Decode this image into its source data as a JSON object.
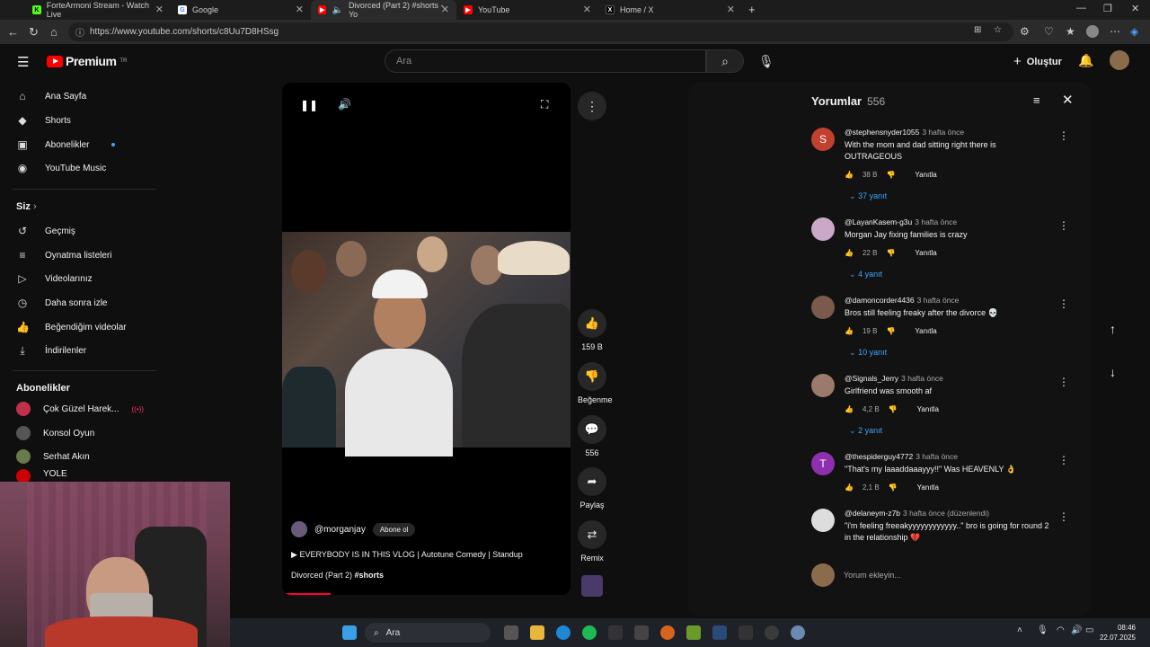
{
  "browser": {
    "tabs": [
      {
        "title": "ForteArmoni Stream - Watch Live",
        "color": "#53fc18",
        "glyph": "K"
      },
      {
        "title": "Google",
        "color": "#4285f4",
        "glyph": "G"
      },
      {
        "title": "Divorced (Part 2) #shorts - Yo",
        "color": "#ff0000",
        "glyph": "▶"
      },
      {
        "title": "YouTube",
        "color": "#ff0000",
        "glyph": "▶"
      },
      {
        "title": "Home / X",
        "color": "#000000",
        "glyph": "X"
      }
    ],
    "url": "https://www.youtube.com/shorts/c8Uu7D8HSsg"
  },
  "header": {
    "brand": "Premium",
    "region": "TR",
    "search_placeholder": "Ara",
    "create_label": "Oluştur"
  },
  "sidebar": {
    "main": [
      {
        "label": "Ana Sayfa",
        "icon": "home-icon",
        "glyph": "⌂"
      },
      {
        "label": "Shorts",
        "icon": "shorts-icon",
        "glyph": "◆"
      },
      {
        "label": "Abonelikler",
        "icon": "subscriptions-icon",
        "glyph": "▣"
      },
      {
        "label": "YouTube Music",
        "icon": "music-icon",
        "glyph": "◉"
      }
    ],
    "you_title": "Siz",
    "you": [
      {
        "label": "Geçmiş",
        "icon": "history-icon",
        "glyph": "↺"
      },
      {
        "label": "Oynatma listeleri",
        "icon": "playlist-icon",
        "glyph": "≡"
      },
      {
        "label": "Videolarınız",
        "icon": "videos-icon",
        "glyph": "▷"
      },
      {
        "label": "Daha sonra izle",
        "icon": "watch-later-icon",
        "glyph": "◷"
      },
      {
        "label": "Beğendiğim videolar",
        "icon": "liked-icon",
        "glyph": "👍"
      },
      {
        "label": "İndirilenler",
        "icon": "download-icon",
        "glyph": "⤓"
      }
    ],
    "subs_title": "Abonelikler",
    "subs": [
      {
        "label": "Çok Güzel Harek...",
        "color": "#c0304a"
      },
      {
        "label": "Konsol Oyun",
        "color": "#555"
      },
      {
        "label": "Serhat Akın",
        "color": "#6b7a4a"
      },
      {
        "label": "YOLE",
        "color": "#cc0000"
      }
    ]
  },
  "short": {
    "channel": "@morganjay",
    "subscribe": "Abone ol",
    "vlog": "EVERYBODY IS IN THIS VLOG | Autotune Comedy | Standup",
    "title": "Divorced (Part 2)",
    "hashtag": "#shorts",
    "progress": 0.16,
    "likes": "159 B",
    "dislike_label": "Beğenme",
    "comments": "556",
    "share_label": "Paylaş",
    "remix_label": "Remix"
  },
  "comments": {
    "title": "Yorumlar",
    "count": "556",
    "add_placeholder": "Yorum ekleyin...",
    "reply_label": "Yanıtla",
    "items": [
      {
        "user": "@stephensnyder1055",
        "time": "3 hafta önce",
        "text": "With the mom and dad sitting right there is OUTRAGEOUS",
        "likes": "38 B",
        "replies": "37 yanıt",
        "avatar": "S",
        "color": "#c2402e"
      },
      {
        "user": "@LayanKasem-g3u",
        "time": "3 hafta önce",
        "text": "Morgan Jay fixing families is crazy",
        "likes": "22 B",
        "replies": "4 yanıt",
        "avatar": "",
        "color": "#c9a8c8"
      },
      {
        "user": "@damoncorder4436",
        "time": "3 hafta önce",
        "text": "Bros still feeling freaky after the divorce 💀",
        "likes": "19 B",
        "replies": "10 yanıt",
        "avatar": "",
        "color": "#7a5a4a"
      },
      {
        "user": "@Signals_Jerry",
        "time": "3 hafta önce",
        "text": "Girlfriend was smooth af",
        "likes": "4,2 B",
        "replies": "2 yanıt",
        "avatar": "",
        "color": "#9a7a6a"
      },
      {
        "user": "@thespiderguy4772",
        "time": "3 hafta önce",
        "text": "\"That's my laaaddaaayyy!!\" Was HEAVENLY 👌",
        "likes": "2,1 B",
        "replies": "",
        "avatar": "T",
        "color": "#8e2fb0"
      },
      {
        "user": "@delaneym-z7b",
        "time": "3 hafta önce (düzenlendi)",
        "text": "\"i'm feeling freeakyyyyyyyyyyyy..\" bro is going for round 2 in the relationship 💔",
        "likes": "",
        "replies": "",
        "avatar": "",
        "color": "#ddd"
      }
    ]
  },
  "taskbar": {
    "search": "Ara",
    "time": "08:46",
    "date": "22.07.2025"
  }
}
